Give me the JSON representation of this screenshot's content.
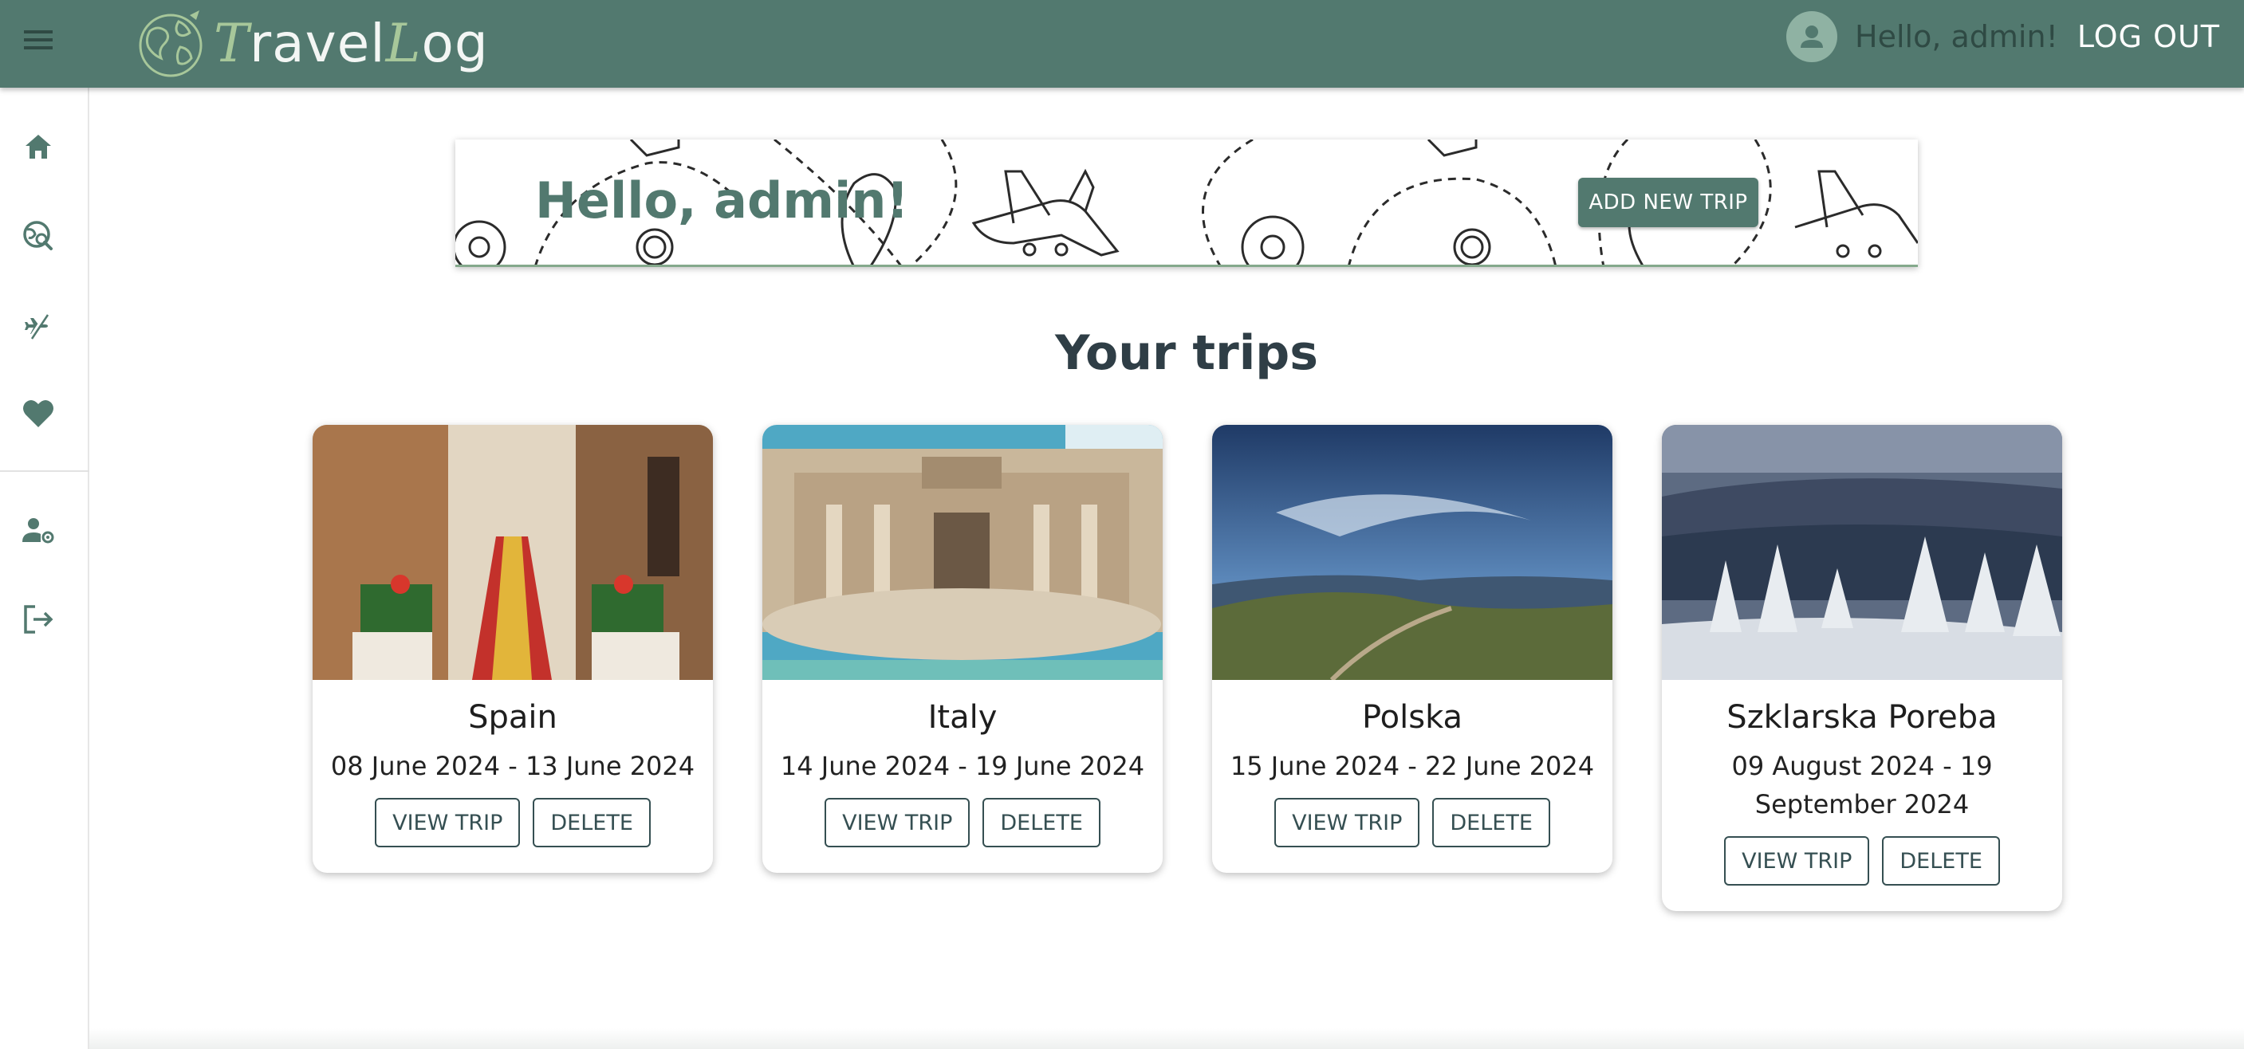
{
  "app": {
    "logo_prefix_1": "T",
    "logo_mid_1": "ravel",
    "logo_prefix_2": "L",
    "logo_mid_2": "og"
  },
  "header": {
    "greeting": "Hello, admin!",
    "logout_label": "LOG OUT"
  },
  "sidebar": {
    "items": [
      {
        "icon": "home-icon"
      },
      {
        "icon": "globe-search-icon"
      },
      {
        "icon": "flight-icon"
      },
      {
        "icon": "heart-icon"
      },
      {
        "icon": "user-settings-icon"
      },
      {
        "icon": "logout-icon"
      }
    ]
  },
  "banner": {
    "title": "Hello, admin!",
    "add_trip_label": "ADD NEW TRIP"
  },
  "main": {
    "section_title": "Your trips",
    "view_label": "VIEW TRIP",
    "delete_label": "DELETE",
    "trips": [
      {
        "name": "Spain",
        "dates": "08 June 2024 - 13 June 2024"
      },
      {
        "name": "Italy",
        "dates": "14 June 2024 - 19 June 2024"
      },
      {
        "name": "Polska",
        "dates": "15 June 2024 - 22 June 2024"
      },
      {
        "name": "Szklarska Poreba",
        "dates": "09 August 2024 - 19 September 2024"
      }
    ]
  },
  "colors": {
    "primary": "#52796f",
    "accent": "#84a98c",
    "dark": "#354f52"
  }
}
